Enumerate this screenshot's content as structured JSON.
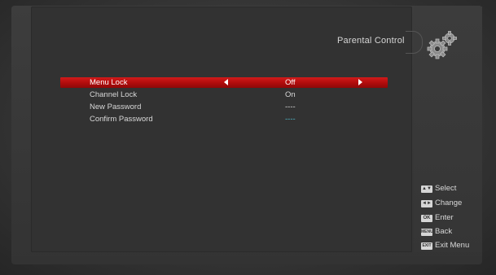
{
  "header": {
    "title": "Parental Control"
  },
  "settings": [
    {
      "label": "Menu Lock",
      "value": "Off"
    },
    {
      "label": "Channel Lock",
      "value": "On"
    },
    {
      "label": "New Password",
      "value": "----"
    },
    {
      "label": "Confirm Password",
      "value": "----"
    }
  ],
  "help": [
    {
      "key": "▲▼",
      "text": "Select"
    },
    {
      "key": "◄►",
      "text": "Change"
    },
    {
      "key": "OK",
      "text": "Enter"
    },
    {
      "key": "MENU",
      "text": "Back"
    },
    {
      "key": "EXIT",
      "text": "Exit Menu"
    }
  ],
  "colors": {
    "highlight": "#c31414",
    "confirm_value": "#4fb8c8"
  }
}
